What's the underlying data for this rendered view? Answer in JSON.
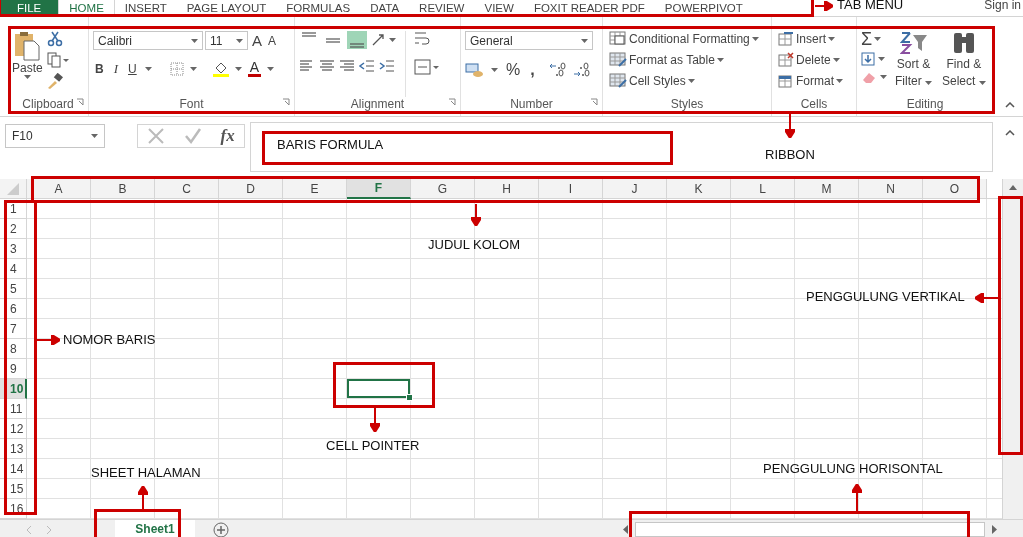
{
  "tabs": [
    {
      "label": "FILE",
      "kind": "file",
      "selected": false
    },
    {
      "label": "HOME",
      "kind": "tab",
      "selected": true
    },
    {
      "label": "INSERT",
      "kind": "tab",
      "selected": false
    },
    {
      "label": "PAGE LAYOUT",
      "kind": "tab",
      "selected": false
    },
    {
      "label": "FORMULAS",
      "kind": "tab",
      "selected": false
    },
    {
      "label": "DATA",
      "kind": "tab",
      "selected": false
    },
    {
      "label": "REVIEW",
      "kind": "tab",
      "selected": false
    },
    {
      "label": "VIEW",
      "kind": "tab",
      "selected": false
    },
    {
      "label": "FOXIT READER PDF",
      "kind": "tab",
      "selected": false
    },
    {
      "label": "POWERPIVOT",
      "kind": "tab",
      "selected": false
    }
  ],
  "account": {
    "sign_in": "Sign in"
  },
  "ribbon": {
    "clipboard": {
      "paste": "Paste",
      "label": "Clipboard"
    },
    "font": {
      "family": "Calibri",
      "size": "11",
      "grow": "A",
      "shrink": "A",
      "bold": "B",
      "italic": "I",
      "underline": "U",
      "font_color": "A",
      "label": "Font"
    },
    "alignment": {
      "vertical": [
        {
          "kind": "top",
          "selected": false
        },
        {
          "kind": "middle",
          "selected": false
        },
        {
          "kind": "bottom",
          "selected": true
        }
      ],
      "label": "Alignment"
    },
    "number": {
      "format": "General",
      "percent": "%",
      "comma": ",",
      "label": "Number"
    },
    "styles": {
      "items": [
        "Conditional Formatting",
        "Format as Table",
        "Cell Styles"
      ],
      "label": "Styles"
    },
    "cells": {
      "items": [
        "Insert",
        "Delete",
        "Format"
      ],
      "label": "Cells"
    },
    "editing": {
      "autosum": "Σ",
      "sort": [
        "Sort &",
        "Filter"
      ],
      "find": [
        "Find &",
        "Select"
      ],
      "label": "Editing"
    }
  },
  "formula_bar": {
    "name_box": "F10",
    "fx": "fx"
  },
  "sheet": {
    "columns": [
      {
        "label": "A",
        "selected": false
      },
      {
        "label": "B",
        "selected": false
      },
      {
        "label": "C",
        "selected": false
      },
      {
        "label": "D",
        "selected": false
      },
      {
        "label": "E",
        "selected": false
      },
      {
        "label": "F",
        "selected": true
      },
      {
        "label": "G",
        "selected": false
      },
      {
        "label": "H",
        "selected": false
      },
      {
        "label": "I",
        "selected": false
      },
      {
        "label": "J",
        "selected": false
      },
      {
        "label": "K",
        "selected": false
      },
      {
        "label": "L",
        "selected": false
      },
      {
        "label": "M",
        "selected": false
      },
      {
        "label": "N",
        "selected": false
      },
      {
        "label": "O",
        "selected": false
      }
    ],
    "rows": [
      {
        "label": "1",
        "selected": false
      },
      {
        "label": "2",
        "selected": false
      },
      {
        "label": "3",
        "selected": false
      },
      {
        "label": "4",
        "selected": false
      },
      {
        "label": "5",
        "selected": false
      },
      {
        "label": "6",
        "selected": false
      },
      {
        "label": "7",
        "selected": false
      },
      {
        "label": "8",
        "selected": false
      },
      {
        "label": "9",
        "selected": false
      },
      {
        "label": "10",
        "selected": true
      },
      {
        "label": "11",
        "selected": false
      },
      {
        "label": "12",
        "selected": false
      },
      {
        "label": "13",
        "selected": false
      },
      {
        "label": "14",
        "selected": false
      },
      {
        "label": "15",
        "selected": false
      },
      {
        "label": "16",
        "selected": false
      }
    ]
  },
  "sheet_tabs": [
    {
      "label": "Sheet1",
      "selected": true
    }
  ],
  "annotations": [
    {
      "text": "TAB MENU"
    },
    {
      "text": "RIBBON"
    },
    {
      "text": "BARIS FORMULA"
    },
    {
      "text": "JUDUL KOLOM"
    },
    {
      "text": "PENGGULUNG VERTIKAL"
    },
    {
      "text": "NOMOR BARIS"
    },
    {
      "text": "CELL POINTER"
    },
    {
      "text": "SHEET HALAMAN"
    },
    {
      "text": "PENGGULUNG HORISONTAL"
    }
  ]
}
